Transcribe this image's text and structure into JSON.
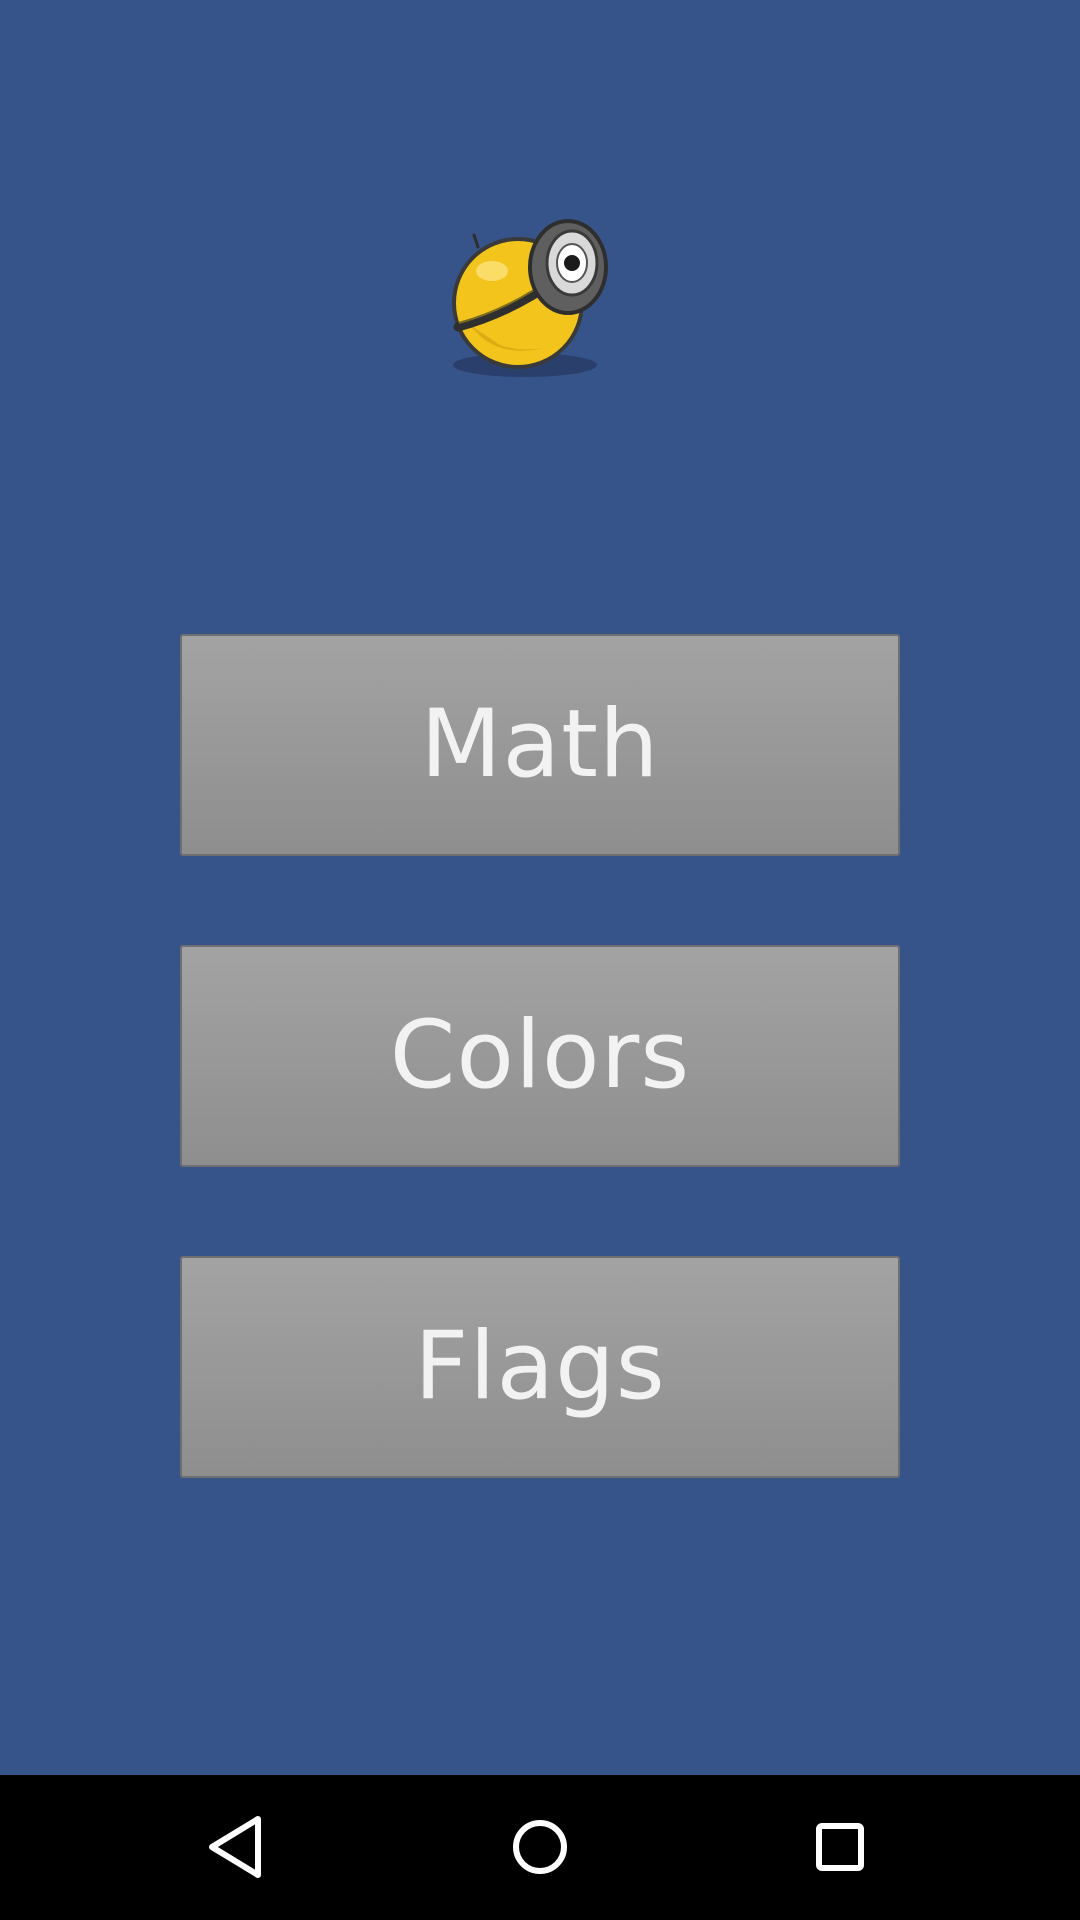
{
  "app": {
    "logo_icon": "minion-ball-icon",
    "background_color": "#37548a"
  },
  "menu": {
    "items": [
      {
        "label": "Math"
      },
      {
        "label": "Colors"
      },
      {
        "label": "Flags"
      }
    ],
    "button_color": "#999999",
    "text_color": "#f2f2f2"
  },
  "navigation_bar": {
    "background_color": "#000000",
    "buttons": [
      {
        "icon": "back-triangle-icon"
      },
      {
        "icon": "home-circle-icon"
      },
      {
        "icon": "recents-square-icon"
      }
    ]
  }
}
